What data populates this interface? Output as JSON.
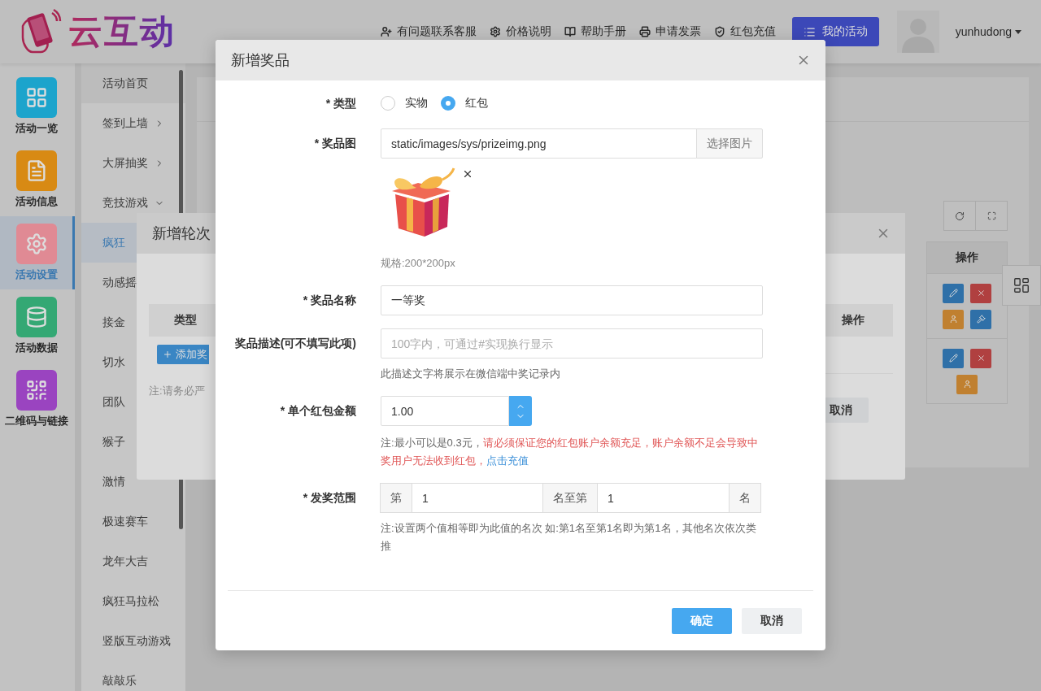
{
  "header": {
    "logo_text": "云互动",
    "links": [
      {
        "label": "有问题联系客服"
      },
      {
        "label": "价格说明"
      },
      {
        "label": "帮助手册"
      },
      {
        "label": "申请发票"
      },
      {
        "label": "红包充值"
      }
    ],
    "my_activity": "我的活动",
    "user": "yunhudong"
  },
  "nav": [
    {
      "label": "活动一览",
      "color": "#1ca4cc",
      "selected": false
    },
    {
      "label": "活动信息",
      "color": "#d88a14",
      "selected": false
    },
    {
      "label": "活动设置",
      "color": "#e08a94",
      "selected": true
    },
    {
      "label": "活动数据",
      "color": "#34a874",
      "selected": false
    },
    {
      "label": "二维码与链接",
      "color": "#9a44c0",
      "selected": false
    }
  ],
  "submenu": [
    {
      "label": "活动首页",
      "selected": false,
      "has_children": false
    },
    {
      "label": "签到上墙",
      "selected": false,
      "has_children": true,
      "expanded": false
    },
    {
      "label": "大屏抽奖",
      "selected": false,
      "has_children": true,
      "expanded": false
    },
    {
      "label": "竞技游戏",
      "selected": false,
      "has_children": true,
      "expanded": true
    },
    {
      "label": "疯狂",
      "selected": true,
      "has_children": false
    },
    {
      "label": "动感摇",
      "selected": false,
      "has_children": false
    },
    {
      "label": "接金",
      "selected": false,
      "has_children": false
    },
    {
      "label": "切水",
      "selected": false,
      "has_children": false
    },
    {
      "label": "团队",
      "selected": false,
      "has_children": false
    },
    {
      "label": "猴子",
      "selected": false,
      "has_children": false
    },
    {
      "label": "激情",
      "selected": false,
      "has_children": false
    },
    {
      "label": "极速赛车",
      "selected": false,
      "has_children": false
    },
    {
      "label": "龙年大吉",
      "selected": false,
      "has_children": false
    },
    {
      "label": "疯狂马拉松",
      "selected": false,
      "has_children": false
    },
    {
      "label": "竖版互动游戏",
      "selected": false,
      "has_children": false
    },
    {
      "label": "敲敲乐",
      "selected": false,
      "has_children": false
    }
  ],
  "main_table": {
    "action_column": "操作"
  },
  "round_dialog": {
    "title": "新增轮次",
    "type_column": "类型",
    "add_button": "添加奖",
    "note": "注:请务必严",
    "action_column": "操作",
    "cancel": "取消"
  },
  "prize_dialog": {
    "title": "新增奖品",
    "fields": [
      {
        "kind": "radio",
        "label": "* 类型",
        "options": [
          {
            "label": "实物",
            "selected": false
          },
          {
            "label": "红包",
            "selected": true
          }
        ]
      },
      {
        "label": "* 奖品图",
        "value": "static/images/sys/prizeimg.png",
        "button": "选择图片",
        "hint": "规格:200*200px"
      },
      {
        "kind": "text",
        "label": "* 奖品名称",
        "value": "一等奖"
      },
      {
        "kind": "text",
        "label": "奖品描述(可不填写此项)",
        "placeholder": "100字内，可通过#实现换行显示",
        "hint": "此描述文字将展示在微信端中奖记录内"
      },
      {
        "kind": "number",
        "label": "* 单个红包金额",
        "value": "1.00",
        "note": "注:最小可以是0.3元，",
        "warning": "请必须保证您的红包账户余额充足，账户余额不足会导致中奖用户无法收到红包，",
        "link": "点击充值"
      },
      {
        "kind": "range",
        "label": "* 发奖范围",
        "prefix": "第",
        "from": "1",
        "middle": "名至第",
        "to": "1",
        "suffix": "名",
        "hint": "注:设置两个值相等即为此值的名次 如:第1名至第1名即为第1名，其他名次依次类推"
      }
    ],
    "buttons": [
      {
        "label": "确定",
        "kind": "primary"
      },
      {
        "label": "取消",
        "kind": "default"
      }
    ]
  }
}
